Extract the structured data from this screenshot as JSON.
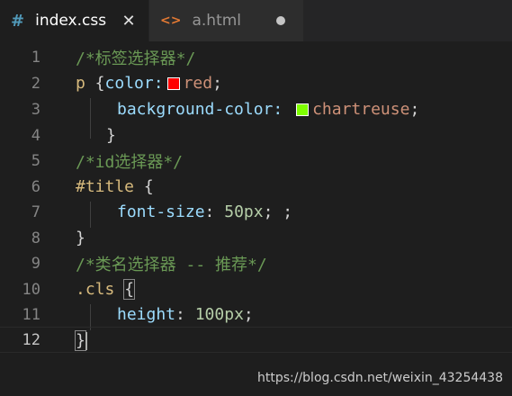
{
  "tabs": [
    {
      "icon": "#",
      "name": "index.css",
      "active": true,
      "close": "✕"
    },
    {
      "icon": "<>",
      "name": "a.html",
      "active": false
    }
  ],
  "lines": {
    "n1": "1",
    "n2": "2",
    "n3": "3",
    "n4": "4",
    "n5": "5",
    "n6": "6",
    "n7": "7",
    "n8": "8",
    "n9": "9",
    "n10": "10",
    "n11": "11",
    "n12": "12"
  },
  "code": {
    "l1_comment": "/*标签选择器*/",
    "l2_sel": "p",
    "l2_open": " {",
    "l2_prop": "color:",
    "l2_val": "red",
    "l2_semi": ";",
    "l2_swatch": "#ff0000",
    "l3_prop": "background-color:",
    "l3_val": "chartreuse",
    "l3_semi": ";",
    "l3_swatch": "#7fff00",
    "l4_close": "}",
    "l5_comment": "/*id选择器*/",
    "l6_sel": "#title",
    "l6_open": " {",
    "l7_prop": "font-size",
    "l7_colon": ": ",
    "l7_num": "50px",
    "l7_rest": "; ;",
    "l8_close": "}",
    "l9_comment": "/*类名选择器 -- 推荐*/",
    "l10_sel": ".cls",
    "l10_open": "{",
    "l11_prop": "height",
    "l11_colon": ": ",
    "l11_num": "100px",
    "l11_semi": ";",
    "l12_close": "}"
  },
  "watermark": "https://blog.csdn.net/weixin_43254438"
}
